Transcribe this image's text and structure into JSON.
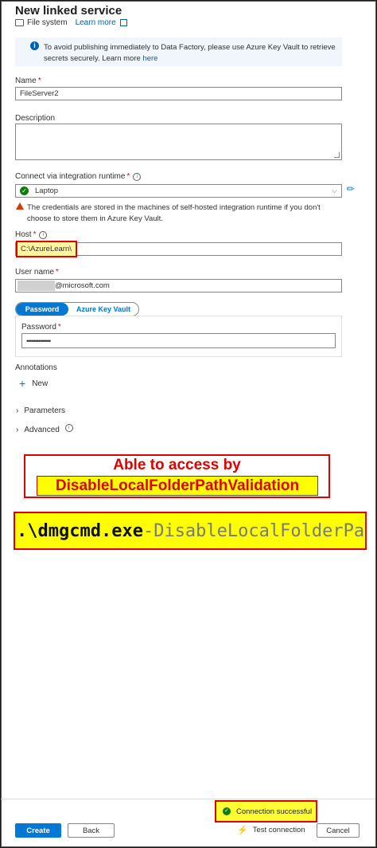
{
  "header": {
    "title": "New linked service",
    "subtitle": "File system",
    "learn_more": "Learn more"
  },
  "info": {
    "text": "To avoid publishing immediately to Data Factory, please use Azure Key Vault to retrieve secrets securely. Learn more",
    "link": "here"
  },
  "form": {
    "name_label": "Name",
    "name_value": "FileServer2",
    "description_label": "Description",
    "description_value": "",
    "runtime_label": "Connect via integration runtime",
    "runtime_value": "Laptop",
    "runtime_warning": "The credentials are stored in the machines of self-hosted integration runtime if you don't choose to store them in Azure Key Vault.",
    "host_label": "Host",
    "host_value": "C:\\AzureLearn\\",
    "username_label": "User name",
    "username_value": "@microsoft.com",
    "auth_tabs": [
      "Password",
      "Azure Key Vault"
    ],
    "password_label": "Password",
    "password_value": "••••••••••••••",
    "required_mark": "*"
  },
  "sections": {
    "annotations_label": "Annotations",
    "new_label": "New",
    "parameters_label": "Parameters",
    "advanced_label": "Advanced"
  },
  "annotation": {
    "line1": "Able to access by",
    "line2": "DisableLocalFolderPathValidation",
    "command_exe": ".\\dmgcmd.exe",
    "command_arg": "-DisableLocalFolderPathValidation"
  },
  "footer": {
    "create_label": "Create",
    "back_label": "Back",
    "test_connection_label": "Test connection",
    "cancel_label": "Cancel",
    "status_text": "Connection successful"
  },
  "colors": {
    "accent": "#0078d4",
    "success": "#107c10",
    "highlight": "#ffff00",
    "annotation_red": "#e00000"
  }
}
